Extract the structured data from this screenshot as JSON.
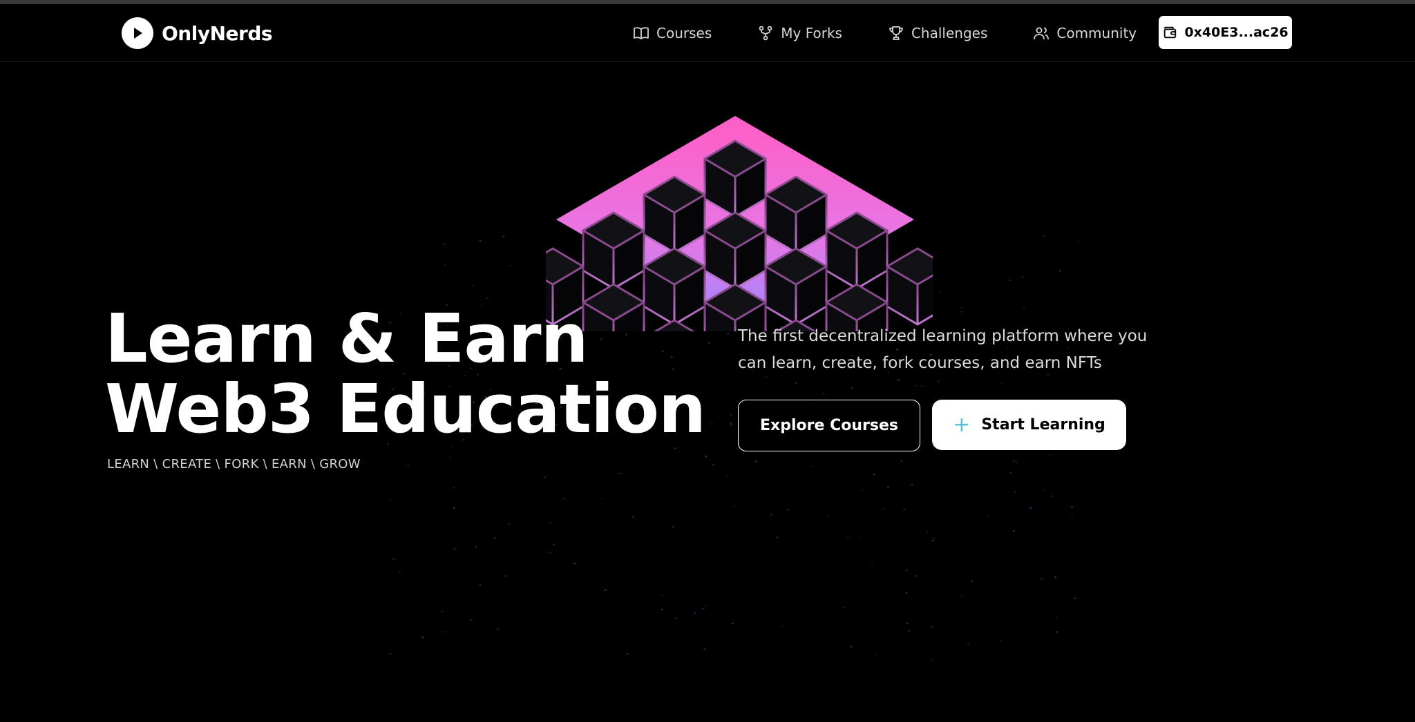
{
  "brand": {
    "name": "OnlyNerds",
    "logo_icon": "play-icon"
  },
  "nav": {
    "items": [
      {
        "label": "Courses",
        "icon": "book-icon"
      },
      {
        "label": "My Forks",
        "icon": "fork-icon"
      },
      {
        "label": "Challenges",
        "icon": "trophy-icon"
      },
      {
        "label": "Community",
        "icon": "users-icon"
      }
    ],
    "wallet": {
      "address": "0x40E3...ac26",
      "icon": "wallet-icon"
    }
  },
  "hero": {
    "title_line1": "Learn & Earn",
    "title_line2": "Web3 Education",
    "tagline": "LEARN \\ CREATE \\ FORK \\ EARN \\ GROW",
    "subtitle": "The first decentralized learning platform where you can learn, create, fork courses, and earn NFTs",
    "explore_label": "Explore Courses",
    "start_label": "Start Learning",
    "start_icon": "plus-icon"
  },
  "colors": {
    "background": "#000000",
    "accent_pink": "#ff4fb8",
    "accent_purple": "#a97bff",
    "accent_cyan": "#58c3d6"
  }
}
